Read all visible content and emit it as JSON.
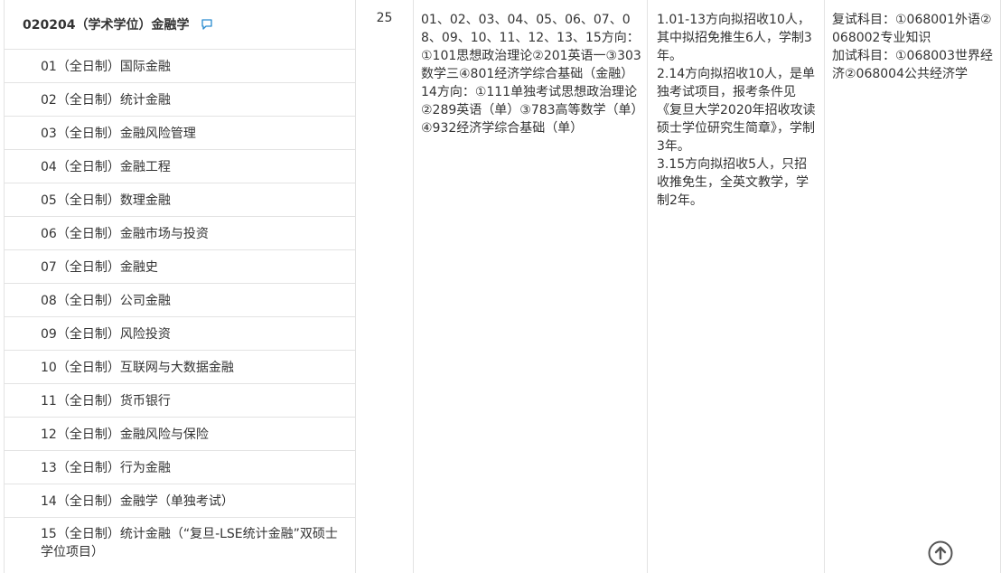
{
  "program": {
    "title": "020204（学术学位）金融学",
    "comment_icon": "comment-icon",
    "directions": [
      "01（全日制）国际金融",
      "02（全日制）统计金融",
      "03（全日制）金融风险管理",
      "04（全日制）金融工程",
      "05（全日制）数理金融",
      "06（全日制）金融市场与投资",
      "07（全日制）金融史",
      "08（全日制）公司金融",
      "09（全日制）风险投资",
      "10（全日制）互联网与大数据金融",
      "11（全日制）货币银行",
      "12（全日制）金融风险与保险",
      "13（全日制）行为金融",
      "14（全日制）金融学（单独考试）",
      "15（全日制）统计金融（“复旦-LSE统计金融”双硕士学位项目）"
    ]
  },
  "enrollment": {
    "count": "25"
  },
  "exam_subjects": {
    "text": "01、02、03、04、05、06、07、08、09、10、11、12、13、15方向：①101思想政治理论②201英语一③303数学三④801经济学综合基础（金融）14方向：①111单独考试思想政治理论②289英语（单）③783高等数学（单）④932经济学综合基础（单）"
  },
  "notes": {
    "text": "1.01-13方向拟招收10人，其中拟招免推生6人，学制3年。\n2.14方向拟招收10人，是单独考试项目，报考条件见《复旦大学2020年招收攻读硕士学位研究生简章》，学制3年。\n3.15方向拟招收5人，只招收推免生，全英文教学，学制2年。"
  },
  "retest": {
    "text": "复试科目：①068001外语②068002专业知识\n加试科目：①068003世界经济②068004公共经济学"
  },
  "back_to_top": {
    "icon": "arrow-up-circle-icon"
  },
  "colors": {
    "border": "#e3e3e3",
    "text": "#333333",
    "accent": "#2a8cd0",
    "icon_dark": "#555555"
  }
}
